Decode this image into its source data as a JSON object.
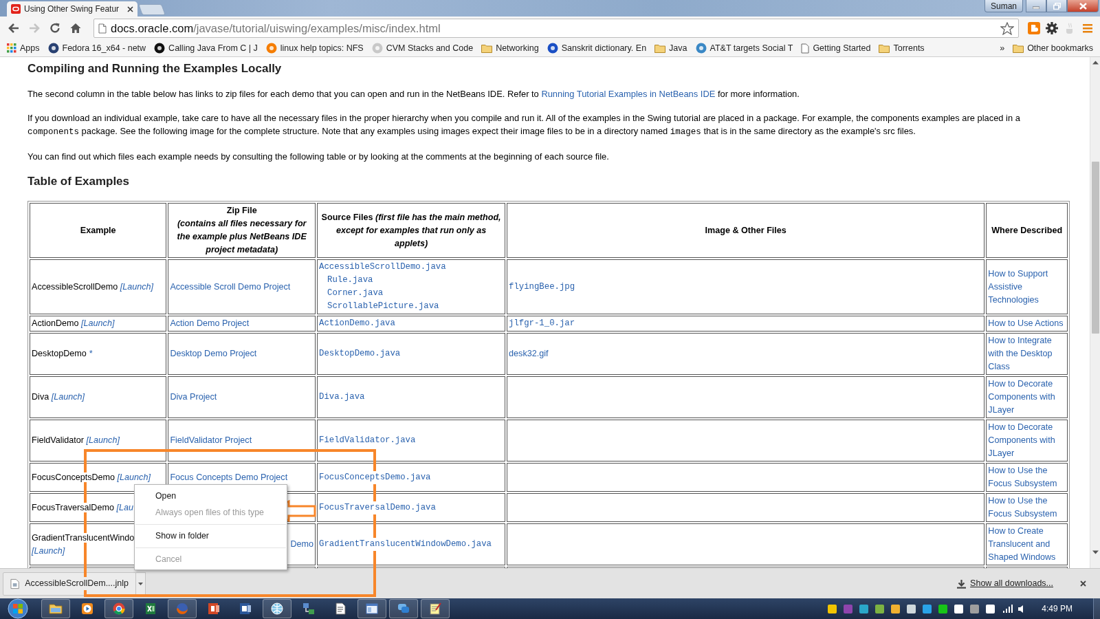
{
  "browser": {
    "tab": {
      "title": "Using Other Swing Featur",
      "selected": true
    },
    "profile": "Suman",
    "nav": {
      "forward_disabled": true
    },
    "address": {
      "host": "docs.oracle.com",
      "path": "/javase/tutorial/uiswing/examples/misc/index.html"
    },
    "bookmarks": [
      {
        "kind": "apps",
        "label": "Apps"
      },
      {
        "kind": "site",
        "label": "Fedora 16_x64 - netw",
        "color": "#294172"
      },
      {
        "kind": "site",
        "label": "Calling Java From C | J",
        "color": "#111111"
      },
      {
        "kind": "site",
        "label": "linux help topics: NFS",
        "color": "#f57d00"
      },
      {
        "kind": "site",
        "label": "CVM Stacks and Code",
        "color": "#c8c8c8"
      },
      {
        "kind": "folder",
        "label": "Networking"
      },
      {
        "kind": "site",
        "label": "Sanskrit dictionary. En",
        "color": "#1a4fc4"
      },
      {
        "kind": "folder",
        "label": "Java"
      },
      {
        "kind": "site",
        "label": "AT&T targets Social T",
        "color": "#3a88c5"
      },
      {
        "kind": "page",
        "label": "Getting Started"
      },
      {
        "kind": "folder",
        "label": "Torrents"
      }
    ],
    "overflow": "»",
    "other_bookmarks": "Other bookmarks"
  },
  "page": {
    "heading": "Compiling and Running the Examples Locally",
    "paragraphs": [
      [
        {
          "kind": "text",
          "text": "The second column in the table below has links to zip files for each demo that you can open and run in the NetBeans IDE. Refer to "
        },
        {
          "kind": "link",
          "text": "Running Tutorial Examples in NetBeans IDE"
        },
        {
          "kind": "text",
          "text": " for more information."
        }
      ],
      [
        {
          "kind": "text",
          "text": "If you download an individual example, take care to have all the necessary files in the proper hierarchy when you compile and run it. All of the examples in the Swing tutorial are placed in a package. For example, the components examples are placed in a "
        },
        {
          "kind": "code",
          "text": "components"
        },
        {
          "kind": "text",
          "text": " package. See the following image for the complete structure. Note that any examples using images expect their image files to be in a directory named "
        },
        {
          "kind": "code",
          "text": "images"
        },
        {
          "kind": "text",
          "text": " that is in the same directory as the example's src files."
        }
      ],
      [
        {
          "kind": "text",
          "text": "You can find out which files each example needs by consulting the following table or by looking at the comments at the beginning of each source file."
        }
      ]
    ],
    "table_heading": "Table of Examples",
    "table": {
      "columns": [
        {
          "title": "Example"
        },
        {
          "title": "Zip File",
          "note": "(contains all files necessary for the example plus NetBeans IDE project metadata)",
          "note_break": true
        },
        {
          "title": "Source Files",
          "note": "(first file has the main method, except for examples that run only as applets)",
          "note_break": false
        },
        {
          "title": "Image & Other Files"
        },
        {
          "title": "Where Described"
        }
      ],
      "rows": [
        {
          "example": "AccessibleScrollDemo",
          "launch": "[Launch]",
          "zip": "Accessible Scroll Demo Project",
          "sources": [
            {
              "text": "AccessibleScrollDemo.java",
              "children": [
                {
                  "text": "Rule.java"
                },
                {
                  "text": "Corner.java"
                },
                {
                  "text": "ScrollablePicture.java"
                }
              ]
            }
          ],
          "files": [
            {
              "kind": "code",
              "text": "flyingBee.jpg"
            }
          ],
          "described": "How to Support Assistive Technologies"
        },
        {
          "example": "ActionDemo",
          "launch": "[Launch]",
          "zip": "Action Demo Project",
          "sources": [
            {
              "text": "ActionDemo.java"
            }
          ],
          "files": [
            {
              "kind": "code",
              "text": "jlfgr-1_0.jar"
            }
          ],
          "described": "How to Use Actions"
        },
        {
          "example": "DesktopDemo",
          "launch": "*",
          "zip": "Desktop Demo Project",
          "sources": [
            {
              "text": "DesktopDemo.java"
            }
          ],
          "files": [
            {
              "kind": "link",
              "text": "desk32.gif"
            }
          ],
          "described": "How to Integrate with the Desktop Class"
        },
        {
          "example": "Diva",
          "launch": "[Launch]",
          "zip": "Diva Project",
          "sources": [
            {
              "text": "Diva.java"
            }
          ],
          "described": "How to Decorate Components with JLayer"
        },
        {
          "example": "FieldValidator",
          "launch": "[Launch]",
          "zip": "FieldValidator Project",
          "sources": [
            {
              "text": "FieldValidator.java"
            }
          ],
          "described": "How to Decorate Components with JLayer"
        },
        {
          "example": "FocusConceptsDemo",
          "launch": "[Launch]",
          "zip": "Focus Concepts Demo Project",
          "sources": [
            {
              "text": "FocusConceptsDemo.java"
            }
          ],
          "described": "How to Use the Focus Subsystem"
        },
        {
          "example": "FocusTraversalDemo",
          "launch": "[Lau",
          "sources": [
            {
              "text": "FocusTraversalDemo.java"
            }
          ],
          "described": "How to Use the Focus Subsystem"
        },
        {
          "example": "GradientTranslucentWindo",
          "launch": "[Launch]",
          "zip": "Demo",
          "zip_cut_start": true,
          "sources": [
            {
              "text": "GradientTranslucentWindowDemo.java"
            }
          ],
          "described": "How to Create Translucent and Shaped Windows"
        }
      ]
    }
  },
  "context_menu": {
    "items": [
      {
        "kind": "item",
        "label": "Open",
        "disabled": false
      },
      {
        "kind": "item",
        "label": "Always open files of this type",
        "disabled": true
      },
      {
        "kind": "separator"
      },
      {
        "kind": "item",
        "label": "Show in folder",
        "disabled": false
      },
      {
        "kind": "separator"
      },
      {
        "kind": "item",
        "label": "Cancel",
        "disabled": true
      }
    ]
  },
  "downloads": {
    "file": "AccessibleScrollDem....jnlp",
    "show_all": "Show all downloads..."
  },
  "taskbar": {
    "apps": [
      {
        "kind": "folder",
        "running": true
      },
      {
        "kind": "media",
        "running": false
      },
      {
        "kind": "chrome",
        "running": true
      },
      {
        "kind": "sheet",
        "running": false
      },
      {
        "kind": "fox",
        "running": true
      },
      {
        "kind": "slides",
        "running": false
      },
      {
        "kind": "doc",
        "running": false
      },
      {
        "kind": "globe",
        "running": true
      },
      {
        "kind": "network",
        "running": false
      },
      {
        "kind": "file",
        "running": false
      },
      {
        "kind": "window",
        "running": true
      },
      {
        "kind": "chat",
        "running": true
      },
      {
        "kind": "notepad",
        "running": true
      }
    ],
    "clock": "4:49 PM"
  }
}
